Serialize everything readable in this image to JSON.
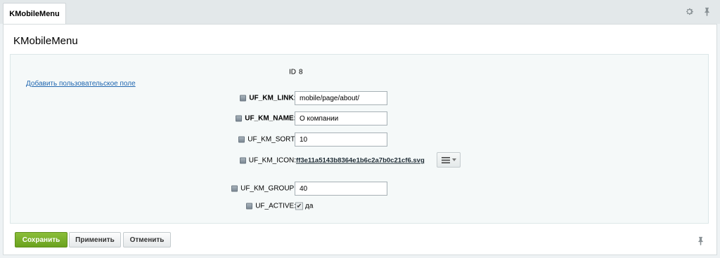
{
  "tab": {
    "label": "KMobileMenu"
  },
  "header": {
    "title": "KMobileMenu"
  },
  "form": {
    "add_user_field_link": "Добавить пользовательское поле",
    "id": {
      "label": "ID",
      "value": "8"
    },
    "fields": {
      "link": {
        "label": "UF_KM_LINK:",
        "value": "mobile/page/about/"
      },
      "name": {
        "label": "UF_KM_NAME:",
        "value": "О компании"
      },
      "sort": {
        "label": "UF_KM_SORT:",
        "value": "10"
      },
      "icon": {
        "label": "UF_KM_ICON:",
        "file": "ff3e11a5143b8364e1b6c2a7b0c21cf6.svg"
      },
      "group": {
        "label": "UF_KM_GROUP:",
        "value": "40"
      },
      "active": {
        "label": "UF_ACTIVE:",
        "checked": true,
        "option_label": "да"
      }
    }
  },
  "footer": {
    "save": "Сохранить",
    "apply": "Применить",
    "cancel": "Отменить"
  },
  "colors": {
    "primary_button": "#7cb22e",
    "link": "#2067b0"
  }
}
